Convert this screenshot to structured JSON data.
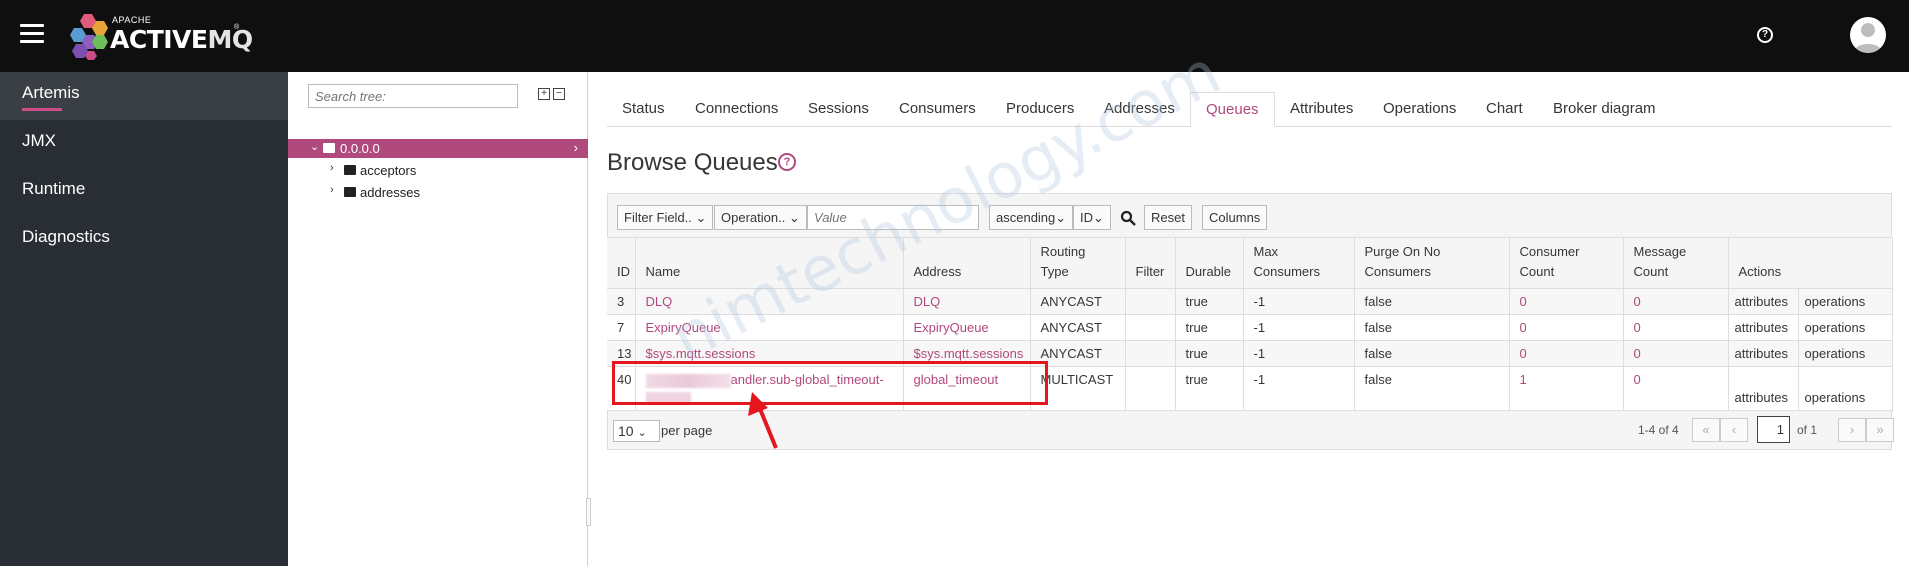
{
  "header": {
    "logo_apache": "APACHE",
    "logo_active": "ACTIVE",
    "logo_mq": "MQ",
    "logo_tm": "®",
    "help_icon": "question-circle-icon",
    "avatar_icon": "user-avatar-icon"
  },
  "sidebar": {
    "items": [
      {
        "label": "Artemis",
        "active": true
      },
      {
        "label": "JMX",
        "active": false
      },
      {
        "label": "Runtime",
        "active": false
      },
      {
        "label": "Diagnostics",
        "active": false
      }
    ]
  },
  "tree": {
    "search_placeholder": "Search tree:",
    "expand_all": "+",
    "collapse_all": "−",
    "root": "0.0.0.0",
    "children": [
      "acceptors",
      "addresses"
    ]
  },
  "tabs": [
    "Status",
    "Connections",
    "Sessions",
    "Consumers",
    "Producers",
    "Addresses",
    "Queues",
    "Attributes",
    "Operations",
    "Chart",
    "Broker diagram"
  ],
  "active_tab": "Queues",
  "page": {
    "title": "Browse Queues",
    "help": "?"
  },
  "toolbar": {
    "filter_field": "Filter Field..",
    "operation": "Operation..",
    "value_placeholder": "Value",
    "sort_order": "ascending",
    "sort_field": "ID",
    "reset": "Reset",
    "columns": "Columns"
  },
  "table": {
    "headers": [
      {
        "l1": "ID",
        "l2": ""
      },
      {
        "l1": "Name",
        "l2": ""
      },
      {
        "l1": "Address",
        "l2": ""
      },
      {
        "l1": "Routing",
        "l2": "Type"
      },
      {
        "l1": "Filter",
        "l2": ""
      },
      {
        "l1": "Durable",
        "l2": ""
      },
      {
        "l1": "Max",
        "l2": "Consumers"
      },
      {
        "l1": "Purge On No",
        "l2": "Consumers"
      },
      {
        "l1": "Consumer",
        "l2": "Count"
      },
      {
        "l1": "Message",
        "l2": "Count"
      },
      {
        "l1": "Actions",
        "l2": ""
      }
    ],
    "rows": [
      {
        "id": "3",
        "name": "DLQ",
        "address": "DLQ",
        "routing": "ANYCAST",
        "filter": "",
        "durable": "true",
        "max_consumers": "-1",
        "purge": "false",
        "consumer_count": "0",
        "message_count": "0",
        "action1": "attributes",
        "action2": "operations"
      },
      {
        "id": "7",
        "name": "ExpiryQueue",
        "address": "ExpiryQueue",
        "routing": "ANYCAST",
        "filter": "",
        "durable": "true",
        "max_consumers": "-1",
        "purge": "false",
        "consumer_count": "0",
        "message_count": "0",
        "action1": "attributes",
        "action2": "operations"
      },
      {
        "id": "13",
        "name": "$sys.mqtt.sessions",
        "address": "$sys.mqtt.sessions",
        "routing": "ANYCAST",
        "filter": "",
        "durable": "true",
        "max_consumers": "-1",
        "purge": "false",
        "consumer_count": "0",
        "message_count": "0",
        "action1": "attributes",
        "action2": "operations"
      },
      {
        "id": "40",
        "name": "andler.sub-global_timeout-",
        "address": "global_timeout",
        "routing": "MULTICAST",
        "filter": "",
        "durable": "true",
        "max_consumers": "-1",
        "purge": "false",
        "consumer_count": "1",
        "message_count": "0",
        "action1": "attributes",
        "action2": "operations"
      }
    ]
  },
  "pager": {
    "per_page": "10",
    "per_page_label": "per page",
    "range": "1-4 of 4",
    "first": "«",
    "prev": "‹",
    "page": "1",
    "of": "of 1",
    "next": "›",
    "last": "»"
  },
  "watermark": "nimtechnology.com",
  "colors": {
    "accent": "#b04a7d",
    "topbar": "#0f0f0f",
    "sidebar": "#292e34",
    "annotation": "#e3171d"
  }
}
